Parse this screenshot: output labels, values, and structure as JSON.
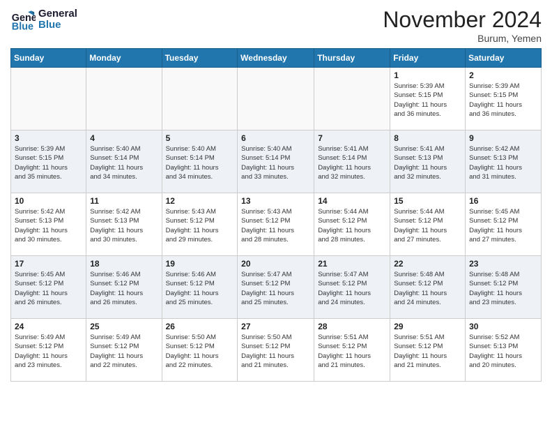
{
  "header": {
    "logo_line1": "General",
    "logo_line2": "Blue",
    "month_title": "November 2024",
    "location": "Burum, Yemen"
  },
  "weekdays": [
    "Sunday",
    "Monday",
    "Tuesday",
    "Wednesday",
    "Thursday",
    "Friday",
    "Saturday"
  ],
  "weeks": [
    [
      {
        "day": "",
        "info": ""
      },
      {
        "day": "",
        "info": ""
      },
      {
        "day": "",
        "info": ""
      },
      {
        "day": "",
        "info": ""
      },
      {
        "day": "",
        "info": ""
      },
      {
        "day": "1",
        "info": "Sunrise: 5:39 AM\nSunset: 5:15 PM\nDaylight: 11 hours\nand 36 minutes."
      },
      {
        "day": "2",
        "info": "Sunrise: 5:39 AM\nSunset: 5:15 PM\nDaylight: 11 hours\nand 36 minutes."
      }
    ],
    [
      {
        "day": "3",
        "info": "Sunrise: 5:39 AM\nSunset: 5:15 PM\nDaylight: 11 hours\nand 35 minutes."
      },
      {
        "day": "4",
        "info": "Sunrise: 5:40 AM\nSunset: 5:14 PM\nDaylight: 11 hours\nand 34 minutes."
      },
      {
        "day": "5",
        "info": "Sunrise: 5:40 AM\nSunset: 5:14 PM\nDaylight: 11 hours\nand 34 minutes."
      },
      {
        "day": "6",
        "info": "Sunrise: 5:40 AM\nSunset: 5:14 PM\nDaylight: 11 hours\nand 33 minutes."
      },
      {
        "day": "7",
        "info": "Sunrise: 5:41 AM\nSunset: 5:14 PM\nDaylight: 11 hours\nand 32 minutes."
      },
      {
        "day": "8",
        "info": "Sunrise: 5:41 AM\nSunset: 5:13 PM\nDaylight: 11 hours\nand 32 minutes."
      },
      {
        "day": "9",
        "info": "Sunrise: 5:42 AM\nSunset: 5:13 PM\nDaylight: 11 hours\nand 31 minutes."
      }
    ],
    [
      {
        "day": "10",
        "info": "Sunrise: 5:42 AM\nSunset: 5:13 PM\nDaylight: 11 hours\nand 30 minutes."
      },
      {
        "day": "11",
        "info": "Sunrise: 5:42 AM\nSunset: 5:13 PM\nDaylight: 11 hours\nand 30 minutes."
      },
      {
        "day": "12",
        "info": "Sunrise: 5:43 AM\nSunset: 5:12 PM\nDaylight: 11 hours\nand 29 minutes."
      },
      {
        "day": "13",
        "info": "Sunrise: 5:43 AM\nSunset: 5:12 PM\nDaylight: 11 hours\nand 28 minutes."
      },
      {
        "day": "14",
        "info": "Sunrise: 5:44 AM\nSunset: 5:12 PM\nDaylight: 11 hours\nand 28 minutes."
      },
      {
        "day": "15",
        "info": "Sunrise: 5:44 AM\nSunset: 5:12 PM\nDaylight: 11 hours\nand 27 minutes."
      },
      {
        "day": "16",
        "info": "Sunrise: 5:45 AM\nSunset: 5:12 PM\nDaylight: 11 hours\nand 27 minutes."
      }
    ],
    [
      {
        "day": "17",
        "info": "Sunrise: 5:45 AM\nSunset: 5:12 PM\nDaylight: 11 hours\nand 26 minutes."
      },
      {
        "day": "18",
        "info": "Sunrise: 5:46 AM\nSunset: 5:12 PM\nDaylight: 11 hours\nand 26 minutes."
      },
      {
        "day": "19",
        "info": "Sunrise: 5:46 AM\nSunset: 5:12 PM\nDaylight: 11 hours\nand 25 minutes."
      },
      {
        "day": "20",
        "info": "Sunrise: 5:47 AM\nSunset: 5:12 PM\nDaylight: 11 hours\nand 25 minutes."
      },
      {
        "day": "21",
        "info": "Sunrise: 5:47 AM\nSunset: 5:12 PM\nDaylight: 11 hours\nand 24 minutes."
      },
      {
        "day": "22",
        "info": "Sunrise: 5:48 AM\nSunset: 5:12 PM\nDaylight: 11 hours\nand 24 minutes."
      },
      {
        "day": "23",
        "info": "Sunrise: 5:48 AM\nSunset: 5:12 PM\nDaylight: 11 hours\nand 23 minutes."
      }
    ],
    [
      {
        "day": "24",
        "info": "Sunrise: 5:49 AM\nSunset: 5:12 PM\nDaylight: 11 hours\nand 23 minutes."
      },
      {
        "day": "25",
        "info": "Sunrise: 5:49 AM\nSunset: 5:12 PM\nDaylight: 11 hours\nand 22 minutes."
      },
      {
        "day": "26",
        "info": "Sunrise: 5:50 AM\nSunset: 5:12 PM\nDaylight: 11 hours\nand 22 minutes."
      },
      {
        "day": "27",
        "info": "Sunrise: 5:50 AM\nSunset: 5:12 PM\nDaylight: 11 hours\nand 21 minutes."
      },
      {
        "day": "28",
        "info": "Sunrise: 5:51 AM\nSunset: 5:12 PM\nDaylight: 11 hours\nand 21 minutes."
      },
      {
        "day": "29",
        "info": "Sunrise: 5:51 AM\nSunset: 5:12 PM\nDaylight: 11 hours\nand 21 minutes."
      },
      {
        "day": "30",
        "info": "Sunrise: 5:52 AM\nSunset: 5:13 PM\nDaylight: 11 hours\nand 20 minutes."
      }
    ]
  ]
}
